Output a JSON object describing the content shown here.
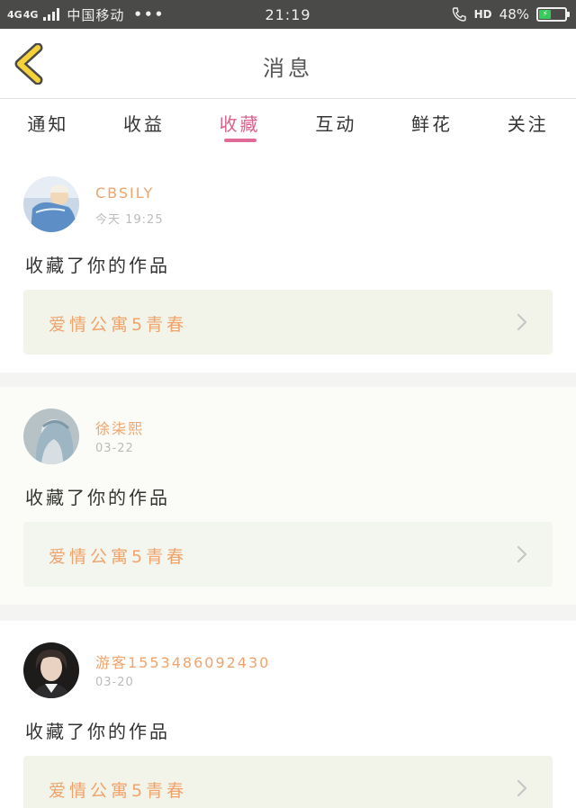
{
  "status_bar": {
    "network_1": "4G",
    "network_2": "4G",
    "carrier": "中国移动",
    "dots": "•••",
    "time": "21:19",
    "hd": "HD",
    "battery": "48%",
    "battery_level": 0.48,
    "battery_color": "#37c95b"
  },
  "nav": {
    "title": "消息",
    "back_icon": "chevron-left-icon",
    "accent": "#f5d13a"
  },
  "tabs": [
    {
      "label": "通知",
      "active": false
    },
    {
      "label": "收益",
      "active": false
    },
    {
      "label": "收藏",
      "active": true
    },
    {
      "label": "互动",
      "active": false
    },
    {
      "label": "鲜花",
      "active": false
    },
    {
      "label": "关注",
      "active": false
    }
  ],
  "messages": [
    {
      "username": "CBSILY",
      "time": "今天 19:25",
      "action": "收藏了你的作品",
      "work": "爱情公寓5青春"
    },
    {
      "username": "徐柒熙",
      "time": "03-22",
      "action": "收藏了你的作品",
      "work": "爱情公寓5青春"
    },
    {
      "username": "游客1553486092430",
      "time": "03-20",
      "action": "收藏了你的作品",
      "work": "爱情公寓5青春"
    }
  ],
  "colors": {
    "active_tab": "#d9628c",
    "username": "#f0a36b",
    "work_title": "#f0a36b"
  }
}
